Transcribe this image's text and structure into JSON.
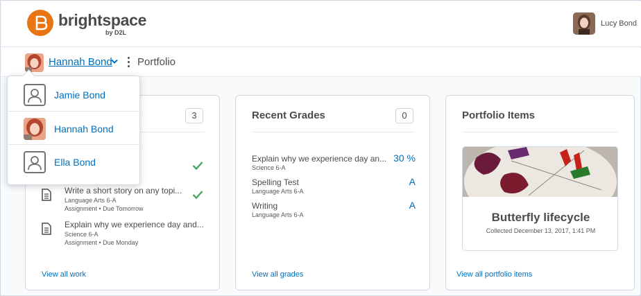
{
  "brand": {
    "name": "brightspace",
    "sub": "by D2L",
    "accent": "#e87511"
  },
  "header": {
    "user_name": "Lucy Bond"
  },
  "nav": {
    "selected_child": "Hannah Bond",
    "page": "Portfolio"
  },
  "dropdown": {
    "items": [
      {
        "label": "Jamie Bond",
        "avatar": "generic-user-icon"
      },
      {
        "label": "Hannah Bond",
        "avatar": "photo"
      },
      {
        "label": "Ella Bond",
        "avatar": "generic-user-icon"
      }
    ]
  },
  "work_card": {
    "count": "3",
    "items": [
      {
        "title": "Write a short story on any topi...",
        "course": "Language Arts 6-A",
        "meta": "Assignment • Due Tomorrow",
        "completed": true
      },
      {
        "title": "Explain why we experience day and...",
        "course": "Science 6-A",
        "meta": "Assignment • Due Monday",
        "completed": false
      }
    ],
    "link": "View all work"
  },
  "grades_card": {
    "title": "Recent Grades",
    "count": "0",
    "items": [
      {
        "name": "Explain why we experience day an...",
        "course": "Science 6-A",
        "grade": "30 %"
      },
      {
        "name": "Spelling Test",
        "course": "Language Arts 6-A",
        "grade": "A"
      },
      {
        "name": "Writing",
        "course": "Language Arts 6-A",
        "grade": "A"
      }
    ],
    "link": "View all grades"
  },
  "portfolio_card": {
    "title": "Portfolio Items",
    "item": {
      "title": "Butterfly lifecycle",
      "collected": "Collected December 13, 2017, 1:41 PM"
    },
    "link": "View all portfolio items"
  },
  "colors": {
    "link": "#006fbf",
    "check": "#46a661",
    "text": "#494c4e"
  }
}
